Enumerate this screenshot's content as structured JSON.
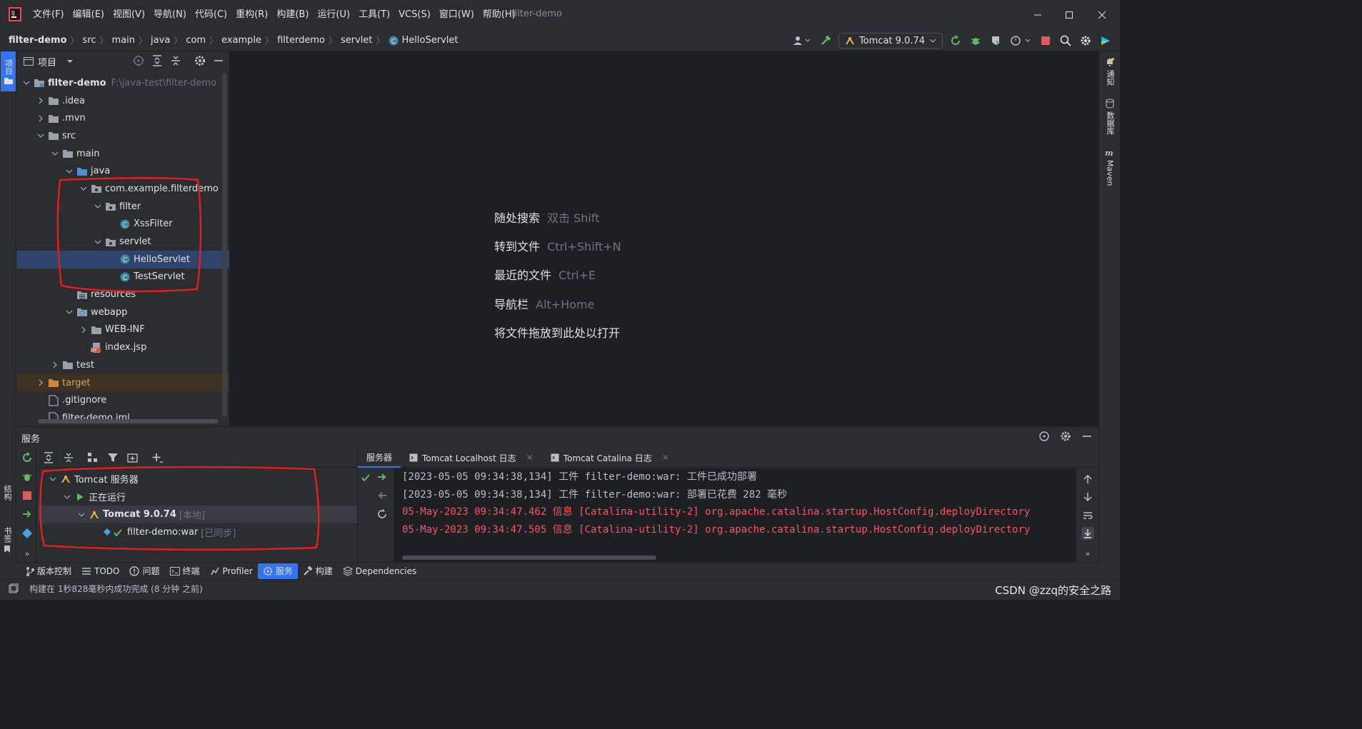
{
  "window": {
    "project_title": "filter-demo",
    "menu": [
      "文件(F)",
      "编辑(E)",
      "视图(V)",
      "导航(N)",
      "代码(C)",
      "重构(R)",
      "构建(B)",
      "运行(U)",
      "工具(T)",
      "VCS(S)",
      "窗口(W)",
      "帮助(H)"
    ]
  },
  "navbar": {
    "breadcrumb": [
      "filter-demo",
      "src",
      "main",
      "java",
      "com",
      "example",
      "filterdemo",
      "servlet",
      "HelloServlet"
    ],
    "run_config": "Tomcat 9.0.74"
  },
  "left_strip": {
    "project_label": "项目",
    "structure_label": "结构",
    "bookmarks_label": "书签"
  },
  "project_panel": {
    "title": "项目",
    "tree": [
      {
        "label": "filter-demo",
        "path": "F:\\java-test\\filter-demo",
        "depth": 0,
        "icon": "module-folder-icon",
        "expanded": true
      },
      {
        "label": ".idea",
        "depth": 1,
        "icon": "folder-icon",
        "expanded": false
      },
      {
        "label": ".mvn",
        "depth": 1,
        "icon": "folder-icon",
        "expanded": false
      },
      {
        "label": "src",
        "depth": 1,
        "icon": "folder-icon",
        "expanded": true
      },
      {
        "label": "main",
        "depth": 2,
        "icon": "folder-icon",
        "expanded": true
      },
      {
        "label": "java",
        "depth": 3,
        "icon": "source-folder-icon",
        "expanded": true
      },
      {
        "label": "com.example.filterdemo",
        "depth": 4,
        "icon": "package-icon",
        "expanded": true
      },
      {
        "label": "filter",
        "depth": 5,
        "icon": "package-icon",
        "expanded": true
      },
      {
        "label": "XssFilter",
        "depth": 6,
        "icon": "class-icon"
      },
      {
        "label": "servlet",
        "depth": 5,
        "icon": "package-icon",
        "expanded": true
      },
      {
        "label": "HelloServlet",
        "depth": 6,
        "icon": "class-icon",
        "selected": true
      },
      {
        "label": "TestServlet",
        "depth": 6,
        "icon": "class-icon"
      },
      {
        "label": "resources",
        "depth": 3,
        "icon": "resources-folder-icon"
      },
      {
        "label": "webapp",
        "depth": 3,
        "icon": "web-folder-icon",
        "expanded": true
      },
      {
        "label": "WEB-INF",
        "depth": 4,
        "icon": "folder-icon",
        "expanded": false
      },
      {
        "label": "index.jsp",
        "depth": 4,
        "icon": "jsp-icon"
      },
      {
        "label": "test",
        "depth": 2,
        "icon": "folder-icon",
        "expanded": false
      },
      {
        "label": "target",
        "depth": 1,
        "icon": "excluded-folder-icon",
        "expanded": false,
        "excluded": true
      },
      {
        "label": ".gitignore",
        "depth": 1,
        "icon": "file-icon"
      },
      {
        "label": "filter-demo.iml",
        "depth": 1,
        "icon": "file-icon"
      }
    ]
  },
  "editor_hints": [
    {
      "label": "随处搜索",
      "key": "双击 Shift"
    },
    {
      "label": "转到文件",
      "key": "Ctrl+Shift+N"
    },
    {
      "label": "最近的文件",
      "key": "Ctrl+E"
    },
    {
      "label": "导航栏",
      "key": "Alt+Home"
    },
    {
      "label": "将文件拖放到此处以打开",
      "key": ""
    }
  ],
  "right_strip": {
    "notifications": "通知",
    "database": "数据库",
    "maven": "Maven"
  },
  "services": {
    "title": "服务",
    "tree": [
      {
        "label": "Tomcat 服务器",
        "depth": 0,
        "icon": "tomcat-icon"
      },
      {
        "label": "正在运行",
        "depth": 1,
        "icon": "run-icon"
      },
      {
        "label": "Tomcat 9.0.74",
        "suffix": "[本地]",
        "depth": 2,
        "icon": "tomcat-icon",
        "selected": true
      },
      {
        "label": "filter-demo:war",
        "suffix": "[已同步]",
        "depth": 3,
        "icon": "artifact-icon"
      }
    ],
    "log_tabs": [
      {
        "label": "服务器",
        "active": true,
        "closable": false
      },
      {
        "label": "Tomcat Localhost 日志",
        "active": false,
        "closable": true
      },
      {
        "label": "Tomcat Catalina 日志",
        "active": false,
        "closable": true
      }
    ],
    "log_lines": [
      {
        "text": "[2023-05-05 09:34:38,134] 工件 filter-demo:war: 工件已成功部署",
        "level": "normal"
      },
      {
        "text": "[2023-05-05 09:34:38,134] 工件 filter-demo:war: 部署已花费 282 毫秒",
        "level": "normal"
      },
      {
        "text": "05-May-2023 09:34:47.462 信息 [Catalina-utility-2] org.apache.catalina.startup.HostConfig.deployDirectory",
        "level": "err"
      },
      {
        "text": "05-May-2023 09:34:47.505 信息 [Catalina-utility-2] org.apache.catalina.startup.HostConfig.deployDirectory",
        "level": "err"
      }
    ]
  },
  "bottom_tabs": [
    {
      "label": "版本控制",
      "icon": "vcs-icon"
    },
    {
      "label": "TODO",
      "icon": "todo-icon"
    },
    {
      "label": "问题",
      "icon": "problems-icon"
    },
    {
      "label": "终端",
      "icon": "terminal-icon"
    },
    {
      "label": "Profiler",
      "icon": "profiler-icon"
    },
    {
      "label": "服务",
      "icon": "services-icon",
      "active": true
    },
    {
      "label": "构建",
      "icon": "build-icon"
    },
    {
      "label": "Dependencies",
      "icon": "dependencies-icon"
    }
  ],
  "status": {
    "message": "构建在 1秒828毫秒内成功完成 (8 分钟 之前)",
    "watermark": "CSDN @zzq的安全之路"
  },
  "colors": {
    "accent": "#3574f0",
    "annotation": "#e0201e",
    "error_log": "#f75464"
  }
}
